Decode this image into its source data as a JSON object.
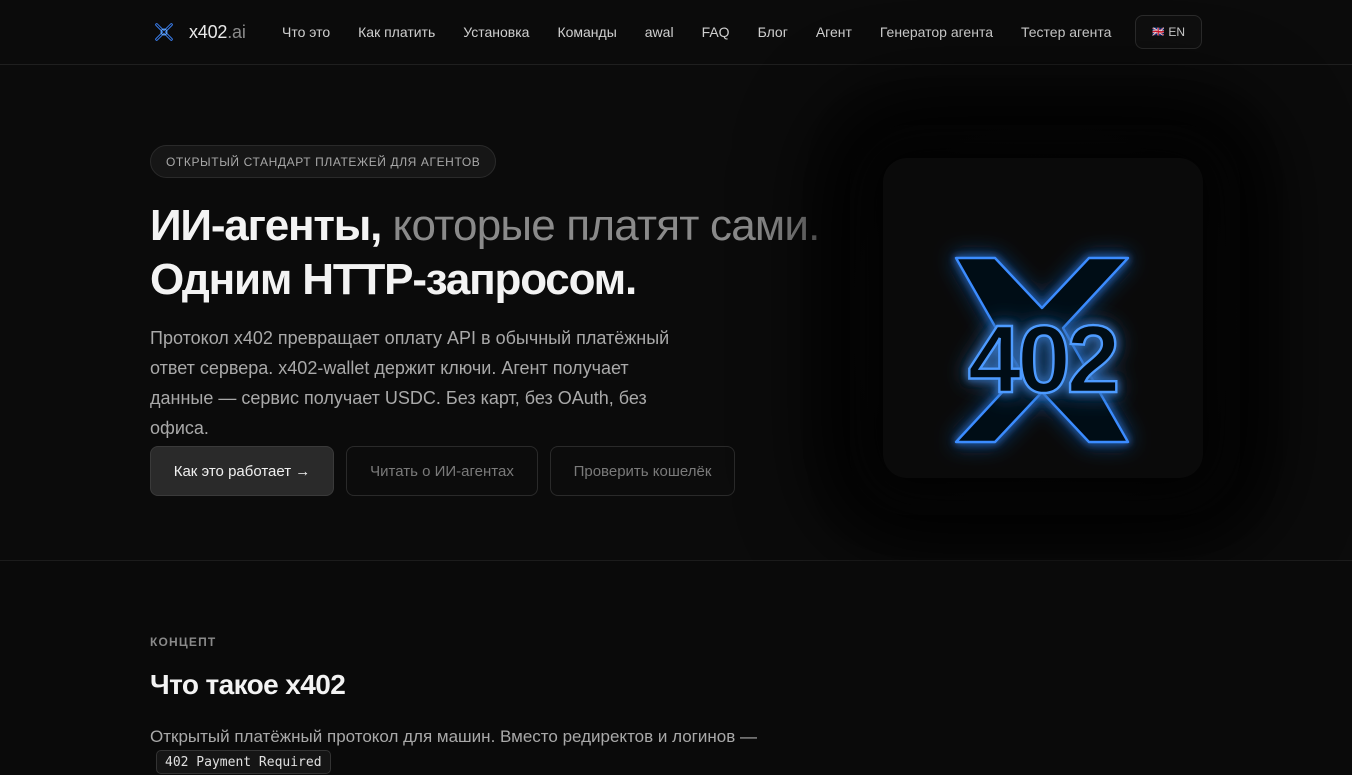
{
  "nav": {
    "brand_main": "x402",
    "brand_tld": ".ai",
    "items": [
      {
        "label": "Что это"
      },
      {
        "label": "Как платить"
      },
      {
        "label": "Установка"
      },
      {
        "label": "Команды"
      },
      {
        "label": "awal"
      },
      {
        "label": "FAQ"
      },
      {
        "label": "Блог"
      },
      {
        "label": "Агент"
      },
      {
        "label": "Генератор агента"
      },
      {
        "label": "Тестер агента"
      }
    ],
    "lang_flag": "🇬🇧",
    "lang_label": "EN"
  },
  "hero": {
    "badge": "ОТКРЫТЫЙ СТАНДАРТ ПЛАТЕЖЕЙ ДЛЯ АГЕНТОВ",
    "title_strong": "ИИ-агенты,",
    "title_muted": " которые платят сами.",
    "title_line2": "Одним HTTP-запросом.",
    "lead": "Протокол x402 превращает оплату API в обычный платёжный ответ сервера. x402-wallet держит ключи. Агент получает данные — сервис получает USDC. Без карт, без OAuth, без офиса.",
    "btn_primary": "Как это работает →",
    "btn_secondary": "Читать о ИИ-агентах",
    "btn_tertiary": "Проверить кошелёк",
    "logo_text": "402",
    "logo_accent": "#3b8cff"
  },
  "concept": {
    "eyebrow": "КОНЦЕПТ",
    "title": "Что такое x402",
    "para_line1": "Открытый платёжный протокол для машин. Вместо редиректов и логинов —",
    "para_pre": "",
    "code_chip": "402 Payment Required",
    "para_post": ""
  }
}
